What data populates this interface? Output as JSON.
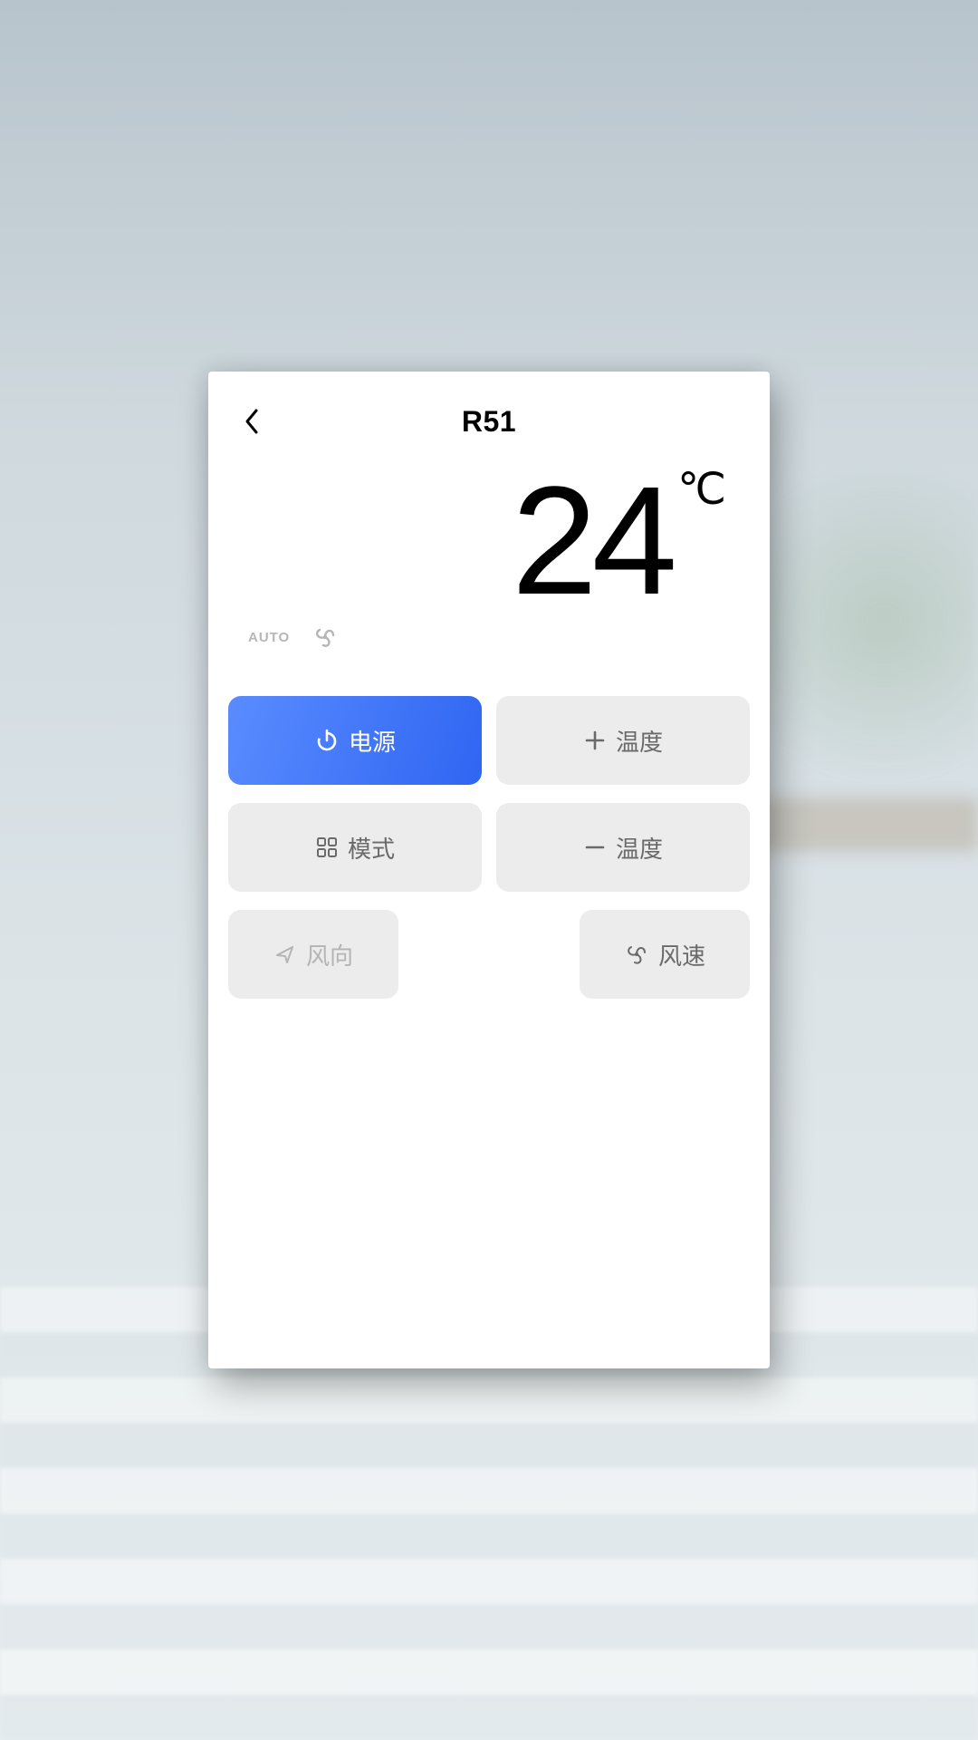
{
  "header": {
    "title": "R51"
  },
  "display": {
    "temperature": "24",
    "unit": "℃",
    "mode_label": "AUTO"
  },
  "buttons": {
    "power": "电源",
    "temp_up": "温度",
    "mode": "模式",
    "temp_down": "温度",
    "wind_dir": "风向",
    "fan_speed": "风速"
  }
}
